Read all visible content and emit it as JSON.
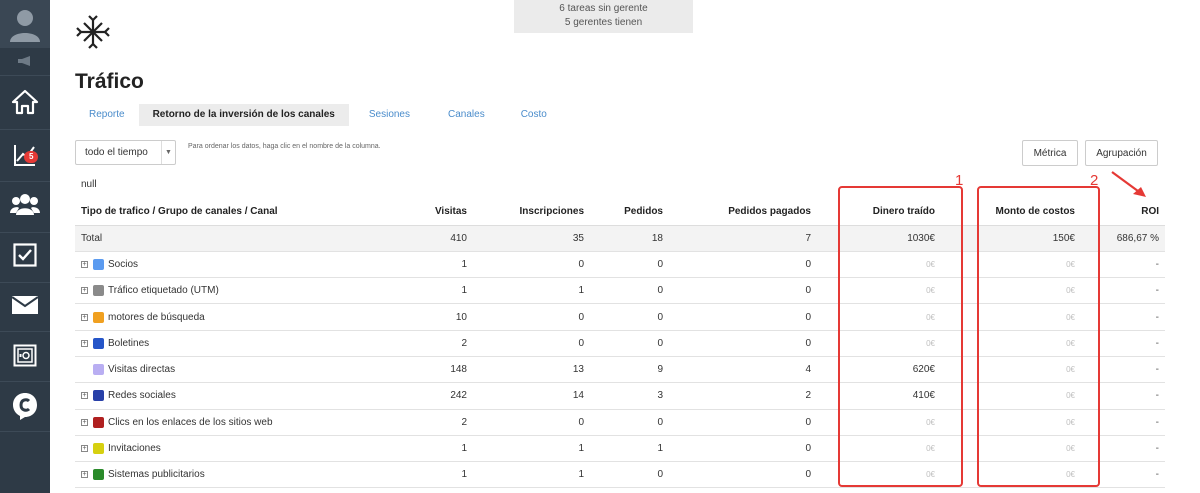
{
  "notice": {
    "line1": "6 tareas sin gerente",
    "line2": "5 gerentes tienen"
  },
  "sidebar": {
    "badge": "5",
    "icons": [
      "user-avatar-icon",
      "megaphone-icon",
      "home-icon",
      "chart-icon",
      "users-icon",
      "checkbox-icon",
      "mail-icon",
      "safe-icon",
      "chat-c-icon"
    ]
  },
  "page_title": "Tráfico",
  "tabs": [
    {
      "label": "Reporte",
      "active": false
    },
    {
      "label": "Retorno de la inversión de los canales",
      "active": true
    },
    {
      "label": "Sesiones",
      "active": false
    },
    {
      "label": "Canales",
      "active": false
    },
    {
      "label": "Costo",
      "active": false
    }
  ],
  "controls": {
    "period": "todo el tiempo",
    "hint": "Para ordenar los datos, haga clic en el nombre de la columna.",
    "metric_button": "Métrica",
    "group_button": "Agrupación"
  },
  "null_label": "null",
  "table": {
    "columns": [
      "Tipo de trafico / Grupo de canales / Canal",
      "Visitas",
      "Inscripciones",
      "Pedidos",
      "Pedidos pagados",
      "Dinero traído",
      "Monto de costos",
      "ROI"
    ],
    "total": [
      "Total",
      "410",
      "35",
      "18",
      "7",
      "1030€",
      "150€",
      "686,67 %"
    ],
    "rows": [
      {
        "name": "Socios",
        "visits": "1",
        "signups": "0",
        "orders": "0",
        "paid": "0",
        "money": "0€",
        "costs": "0€",
        "roi": "-",
        "icon_color": "#5b9bf0"
      },
      {
        "name": "Tráfico etiquetado (UTM)",
        "visits": "1",
        "signups": "1",
        "orders": "0",
        "paid": "0",
        "money": "0€",
        "costs": "0€",
        "roi": "-",
        "icon_color": "#8a8a8a"
      },
      {
        "name": "motores de búsqueda",
        "visits": "10",
        "signups": "0",
        "orders": "0",
        "paid": "0",
        "money": "0€",
        "costs": "0€",
        "roi": "-",
        "icon_color": "#f0a020"
      },
      {
        "name": "Boletines",
        "visits": "2",
        "signups": "0",
        "orders": "0",
        "paid": "0",
        "money": "0€",
        "costs": "0€",
        "roi": "-",
        "icon_color": "#2555c8"
      },
      {
        "name": "Visitas directas",
        "visits": "148",
        "signups": "13",
        "orders": "9",
        "paid": "4",
        "money": "620€",
        "costs": "0€",
        "roi": "-",
        "icon_color": "#b9aef2"
      },
      {
        "name": "Redes sociales",
        "visits": "242",
        "signups": "14",
        "orders": "3",
        "paid": "2",
        "money": "410€",
        "costs": "0€",
        "roi": "-",
        "icon_color": "#2840a8"
      },
      {
        "name": "Clics en los enlaces de los sitios web",
        "visits": "2",
        "signups": "0",
        "orders": "0",
        "paid": "0",
        "money": "0€",
        "costs": "0€",
        "roi": "-",
        "icon_color": "#b02020"
      },
      {
        "name": "Invitaciones",
        "visits": "1",
        "signups": "1",
        "orders": "1",
        "paid": "0",
        "money": "0€",
        "costs": "0€",
        "roi": "-",
        "icon_color": "#d6d010"
      },
      {
        "name": "Sistemas publicitarios",
        "visits": "1",
        "signups": "1",
        "orders": "0",
        "paid": "0",
        "money": "0€",
        "costs": "0€",
        "roi": "-",
        "icon_color": "#2a8a2a"
      }
    ]
  },
  "annotations": {
    "label1": "1",
    "label2": "2",
    "color": "#e53935"
  }
}
